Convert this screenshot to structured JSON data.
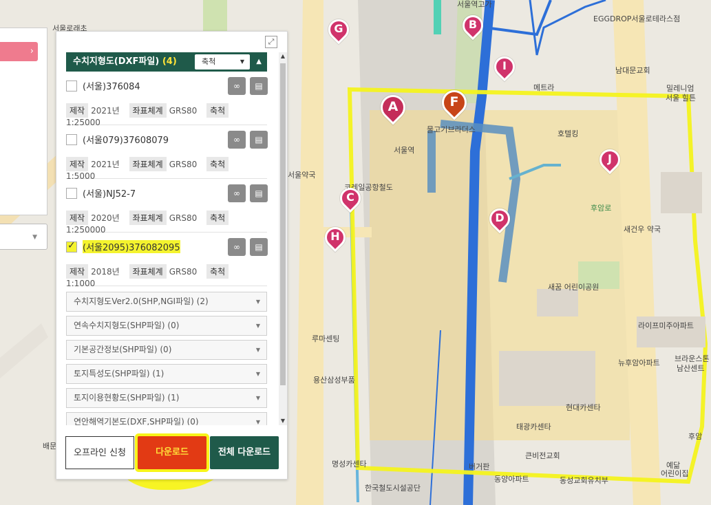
{
  "map": {
    "labels": [
      {
        "text": "서울로래초"
      },
      {
        "text": "서울역고가"
      },
      {
        "text": "EGGDROP서울로테라스점"
      },
      {
        "text": "남대문교회"
      },
      {
        "text": "메트라"
      },
      {
        "text": "밀레니엄"
      },
      {
        "text": "서울 힐튼"
      },
      {
        "text": "물고기브라더스"
      },
      {
        "text": "서울역"
      },
      {
        "text": "호텔킹"
      },
      {
        "text": "코레일공항철도"
      },
      {
        "text": "서울약국"
      },
      {
        "text": "후암로"
      },
      {
        "text": "새건우 약국"
      },
      {
        "text": "새꿈 어린이공원"
      },
      {
        "text": "라이프미주아파트"
      },
      {
        "text": "뉴후암아파트"
      },
      {
        "text": "브라운스톤"
      },
      {
        "text": "남산센트"
      },
      {
        "text": "루마센팅"
      },
      {
        "text": "용산삼성부품"
      },
      {
        "text": "현대카센타"
      },
      {
        "text": "태광카센타"
      },
      {
        "text": "버거판"
      },
      {
        "text": "큰비전교회"
      },
      {
        "text": "명성카센타"
      },
      {
        "text": "동양아파트"
      },
      {
        "text": "동성교회유치부"
      },
      {
        "text": "한국철도시설공단"
      },
      {
        "text": "예닮"
      },
      {
        "text": "어린이집"
      },
      {
        "text": "후암"
      },
      {
        "text": "배문"
      }
    ],
    "markers": [
      "G",
      "B",
      "I",
      "A",
      "F",
      "J",
      "C",
      "D",
      "H"
    ]
  },
  "panel": {
    "category": {
      "title": "수치지형도(DXF파일)",
      "count": "(4)",
      "filter": "축척",
      "toggle": "▲"
    },
    "items": [
      {
        "name": "(서울)376084",
        "checked": false,
        "year": "2021년",
        "crs": "GRS80",
        "scale": "1:25000"
      },
      {
        "name": "(서울079)37608079",
        "checked": false,
        "year": "2021년",
        "crs": "GRS80",
        "scale": "1:5000"
      },
      {
        "name": "(서울)NJ52-7",
        "checked": false,
        "year": "2020년",
        "crs": "GRS80",
        "scale": "1:250000"
      },
      {
        "name": "(서울2095)376082095",
        "checked": true,
        "year": "2018년",
        "crs": "GRS80",
        "scale": "1:1000"
      }
    ],
    "labels": {
      "make": "제작",
      "crs": "좌표체계",
      "scale": "축척"
    },
    "other_categories": [
      "수치지형도Ver2.0(SHP,NGI파일) (2)",
      "연속수치지형도(SHP파일) (0)",
      "기본공간정보(SHP파일) (0)",
      "토지특성도(SHP파일) (1)",
      "토지이용현황도(SHP파일) (1)",
      "연안해역기본도(DXF,SHP파일) (0)"
    ],
    "buttons": {
      "offline": "오프라인 신청",
      "download": "다운로드",
      "all": "전체 다운로드"
    }
  },
  "colors": {
    "panel_green": "#1f5a4a",
    "download_red": "#e23a14",
    "highlight_yellow": "#f4f32e",
    "marker_pink": "#d0336b"
  }
}
